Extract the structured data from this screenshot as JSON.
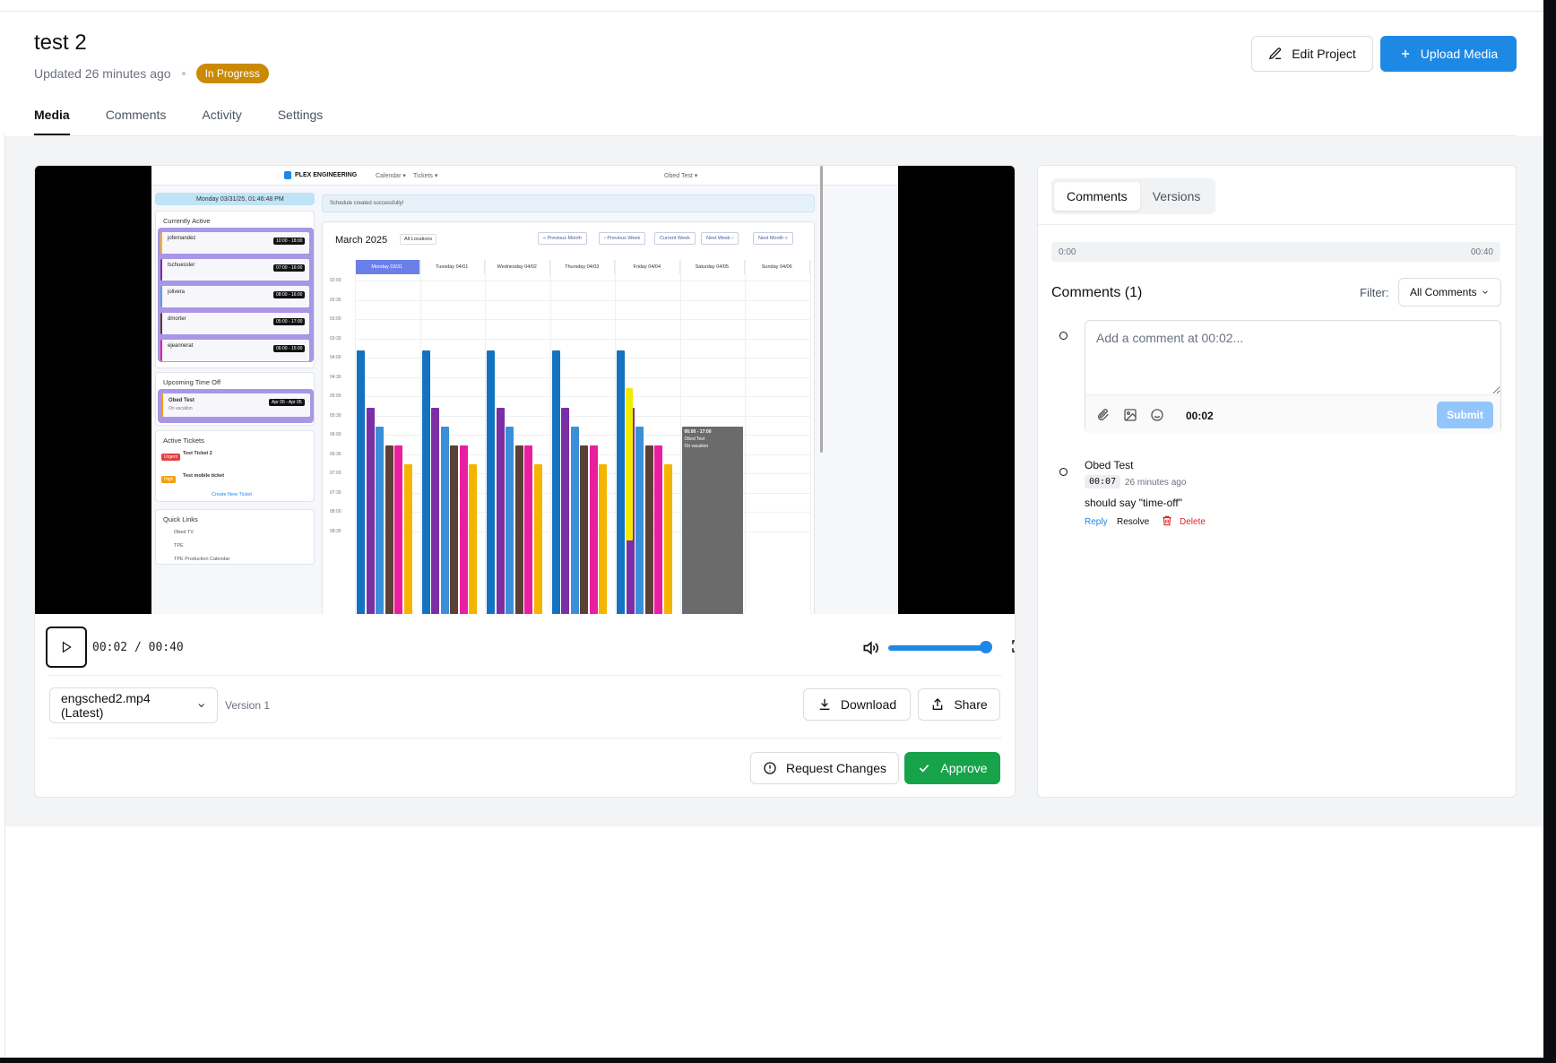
{
  "project": {
    "title": "test 2",
    "updated": "Updated 26 minutes ago",
    "status": "In Progress",
    "status_color": "#ca8a04"
  },
  "header_actions": {
    "edit_label": "Edit Project",
    "upload_label": "Upload Media"
  },
  "tabs": [
    {
      "label": "Media",
      "active": true
    },
    {
      "label": "Comments",
      "active": false
    },
    {
      "label": "Activity",
      "active": false
    },
    {
      "label": "Settings",
      "active": false
    }
  ],
  "player": {
    "current_time": "00:02",
    "duration": "00:40",
    "time_separator": "/",
    "volume": 0.95,
    "file": "engsched2.mp4 (Latest)",
    "version": "Version 1",
    "download_label": "Download",
    "share_label": "Share",
    "request_changes_label": "Request Changes",
    "approve_label": "Approve"
  },
  "video_frame": {
    "brand": "PLEX ENGINEERING",
    "nav": [
      "Calendar ▾",
      "Tickets ▾"
    ],
    "user": "Obed Test ▾",
    "datetime": "Monday 03/31/25, 01:46:48 PM",
    "notice": "Schedule created successfully!",
    "active_title": "Currently Active",
    "active_users": [
      {
        "name": "jofernandez",
        "time": "10:00 - 18:00",
        "color": "#f5b400"
      },
      {
        "name": "tschuessler",
        "time": "07:00 - 16:00",
        "color": "#7b2fa5"
      },
      {
        "name": "jolivera",
        "time": "08:00 - 16:00",
        "color": "#5a9ee8"
      },
      {
        "name": "dmorter",
        "time": "05:00 - 17:00",
        "color": "#5a4035"
      },
      {
        "name": "ejeannerat",
        "time": "06:00 - 15:00",
        "color": "#e91ea0"
      }
    ],
    "timeoff_title": "Upcoming Time Off",
    "timeoff_item": {
      "name": "Obed Test",
      "note": "On vacation",
      "range": "Apr 05 - Apr 05"
    },
    "tickets_title": "Active Tickets",
    "tickets": [
      {
        "tag": "Urgent",
        "title": "Test Ticket 2",
        "color": "#e53e3e"
      },
      {
        "tag": "High",
        "title": "Test mobile ticket",
        "color": "#f59e0b"
      }
    ],
    "create_ticket": "Create New Ticket",
    "links_title": "Quick Links",
    "links": [
      "Obed TV",
      "TPE",
      "TPE Production Calendar"
    ],
    "month": "March 2025",
    "location": "All Locations",
    "nav_buttons": [
      "« Previous Month",
      "‹ Previous Week",
      "Current Week",
      "Next Week ›",
      "Next Month »"
    ],
    "days": [
      "Monday 03/31",
      "Tuesday 04/01",
      "Wednesday 04/02",
      "Thursday 04/03",
      "Friday 04/04",
      "Saturday 04/05",
      "Sunday 04/06"
    ],
    "hours": [
      "02:00",
      "02:30",
      "03:00",
      "03:30",
      "04:00",
      "04:30",
      "05:00",
      "05:30",
      "06:00",
      "06:30",
      "07:00",
      "07:30",
      "08:00",
      "08:30"
    ],
    "timeoff_block": {
      "time": "06:00 - 17:00",
      "name": "Obed Test",
      "note": "On vacation"
    }
  },
  "sidebar": {
    "tabs": [
      {
        "label": "Comments",
        "active": true
      },
      {
        "label": "Versions",
        "active": false
      }
    ],
    "timeline_start": "0:00",
    "timeline_end": "00:40",
    "comments_title": "Comments (1)",
    "filter_label": "Filter:",
    "filter_value": "All Comments",
    "input_placeholder": "Add a comment at 00:02...",
    "input_time": "00:02",
    "submit_label": "Submit",
    "comments": [
      {
        "author": "Obed Test",
        "timestamp": "00:07",
        "ago": "26 minutes ago",
        "text": "should say \"time-off\"",
        "reply": "Reply",
        "resolve": "Resolve",
        "delete": "Delete"
      }
    ]
  },
  "colors": {
    "primary": "#1e88e5",
    "approve": "#16a34a",
    "delete": "#dc2626"
  }
}
